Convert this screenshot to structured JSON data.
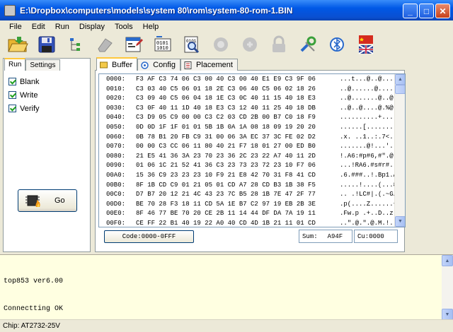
{
  "window": {
    "title": "E:\\Dropbox\\computers\\models\\system 80\\rom\\system-80-rom-1.BIN",
    "btn_min": "_",
    "btn_max": "□",
    "btn_close": "✕"
  },
  "menu": [
    "File",
    "Edit",
    "Run",
    "Display",
    "Tools",
    "Help"
  ],
  "toolbar": {
    "icons": [
      "open-folder-icon",
      "save-disk-icon",
      "tree-icon",
      "eraser-icon",
      "hex-edit-icon",
      "binary-view-icon",
      "binary-search-icon",
      "chip-disabled-icon",
      "chip-disabled-2-icon",
      "lock-icon",
      "tools-icon",
      "bluetooth-icon",
      "language-flag-icon"
    ]
  },
  "left_tabs": {
    "run": "Run",
    "settings": "Settings"
  },
  "checks": {
    "blank": "Blank",
    "write": "Write",
    "verify": "Verify"
  },
  "go_label": "Go",
  "main_tabs": {
    "buffer": "Buffer",
    "config": "Config",
    "placement": "Placement"
  },
  "hex": [
    {
      "addr": "0000:",
      "bytes": "F3 AF C3 74 06 C3 00 40 C3 00 40 E1 E9 C3 9F 06",
      "ascii": "...t...@..@...."
    },
    {
      "addr": "0010:",
      "bytes": "C3 03 40 C5 06 01 18 2E C3 06 40 C5 06 02 18 26",
      "ascii": "..@......@.....&"
    },
    {
      "addr": "0020:",
      "bytes": "C3 09 40 C5 06 04 18 1E C3 0C 40 11 15 40 18 E3",
      "ascii": "..@.......@..@.."
    },
    {
      "addr": "0030:",
      "bytes": "C3 0F 40 11 1D 40 18 E3 C3 12 40 11 25 40 18 DB",
      "ascii": "..@..@....@.%@.."
    },
    {
      "addr": "0040:",
      "bytes": "C3 D9 05 C9 00 00 C3 C2 03 CD 2B 00 B7 C0 18 F9",
      "ascii": "..........+....."
    },
    {
      "addr": "0050:",
      "bytes": "0D 0D 1F 1F 01 01 5B 1B 0A 1A 08 18 09 19 20 20",
      "ascii": "......[........."
    },
    {
      "addr": "0060:",
      "bytes": "0B 78 B1 20 FB C9 31 00 06 3A EC 37 3C FE 02 D2",
      "ascii": ".x. ..1..:.7<..."
    },
    {
      "addr": "0070:",
      "bytes": "00 00 C3 CC 06 11 80 40 21 F7 18 01 27 00 ED B0",
      "ascii": ".......@!...'..."
    },
    {
      "addr": "0080:",
      "bytes": "21 E5 41 36 3A 23 70 23 36 2C 23 22 A7 40 11 2D",
      "ascii": "!.A6:#p#6,#\".@.-"
    },
    {
      "addr": "0090:",
      "bytes": "01 06 1C 21 52 41 36 C3 23 73 23 72 23 10 F7 06",
      "ascii": "...!RA6.#s#r#..."
    },
    {
      "addr": "00A0:",
      "bytes": "15 36 C9 23 23 23 10 F9 21 E8 42 70 31 F8 41 CD",
      "ascii": ".6.###..!.Bp1.A."
    },
    {
      "addr": "00B0:",
      "bytes": "8F 1B CD C9 01 21 05 01 CD A7 28 CD B3 1B 38 F5",
      "ascii": ".....!....(...8."
    },
    {
      "addr": "00C0:",
      "bytes": "D7 B7 20 12 21 4C 43 23 7C B5 28 1B 7E 47 2F 77",
      "ascii": ".. .!LC#|.(.~G/w"
    },
    {
      "addr": "00D0:",
      "bytes": "BE 70 28 F3 18 11 CD 5A 1E B7 C2 97 19 EB 2B 3E",
      "ascii": ".p(....Z......+>"
    },
    {
      "addr": "00E0:",
      "bytes": "8F 46 77 BE 70 20 CE 2B 11 14 44 DF DA 7A 19 11",
      "ascii": ".Fw.p .+..D..z.."
    },
    {
      "addr": "00F0:",
      "bytes": "CE FF 22 B1 40 19 22 A0 40 CD 4D 1B 21 11 01 CD",
      "ascii": "..\".@.\".@.M.!..."
    }
  ],
  "code_label": "Code:0000-0FFF",
  "sum_label": "Sum:",
  "sum_value": "A94F",
  "cu_label": "Cu:0000",
  "log": [
    "top853 ver6.00",
    "Connectting OK"
  ],
  "status": "Chip:  AT2732-25V",
  "colors": {
    "title_blue": "#0058e6",
    "log_bg": "#ffffe1",
    "tab_accent": "#ffc83c"
  }
}
